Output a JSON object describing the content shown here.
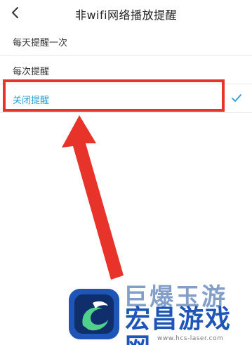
{
  "header": {
    "title": "非wifi网络播放提醒",
    "back_icon": "chevron-left-icon"
  },
  "options": [
    {
      "label": "每天提醒一次",
      "selected": false
    },
    {
      "label": "每次提醒",
      "selected": false
    },
    {
      "label": "关闭提醒",
      "selected": true
    }
  ],
  "colors": {
    "accent": "#2a9fd6",
    "annotation": "#e8332a",
    "watermark_blue": "#1e56b8"
  },
  "watermark": {
    "top_text": "巨爆玉游",
    "brand": "宏昌游戏网",
    "url": "www.hcs-laser.com"
  }
}
